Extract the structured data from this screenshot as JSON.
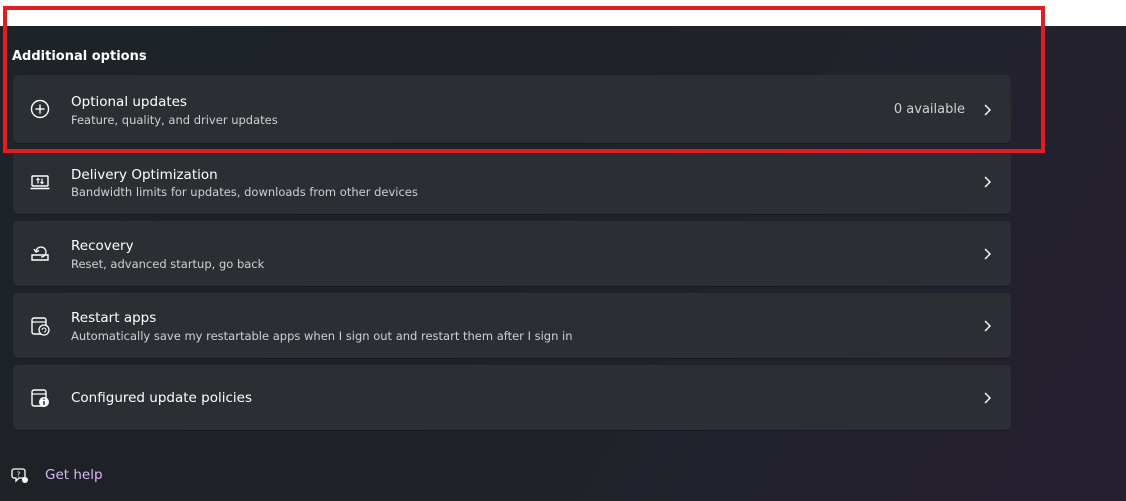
{
  "section": {
    "title": "Additional options"
  },
  "items": [
    {
      "title": "Optional updates",
      "subtitle": "Feature, quality, and driver updates",
      "right_text": "0 available",
      "icon": "plus-circle-icon"
    },
    {
      "title": "Delivery Optimization",
      "subtitle": "Bandwidth limits for updates, downloads from other devices",
      "icon": "delivery-optimization-icon"
    },
    {
      "title": "Recovery",
      "subtitle": "Reset, advanced startup, go back",
      "icon": "recovery-icon"
    },
    {
      "title": "Restart apps",
      "subtitle": "Automatically save my restartable apps when I sign out and restart them after I sign in",
      "icon": "restart-apps-icon"
    },
    {
      "title": "Configured update policies",
      "icon": "policy-info-icon"
    }
  ],
  "help": {
    "label": "Get help",
    "icon": "help-icon"
  },
  "colors": {
    "highlight": "#e31b23",
    "card": "#2b2f33",
    "link": "#d9b8f1"
  }
}
